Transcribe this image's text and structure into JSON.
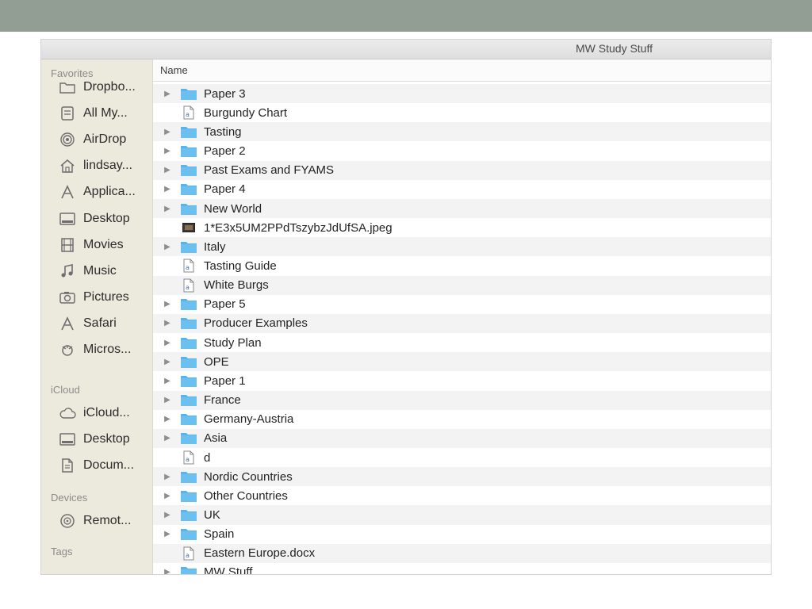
{
  "window": {
    "title": "MW Study Stuff"
  },
  "sidebar": {
    "sections": [
      {
        "heading": "Favorites",
        "items": [
          {
            "label": "Dropbo...",
            "icon": "folder-icon"
          },
          {
            "label": "All My...",
            "icon": "all-files-icon"
          },
          {
            "label": "AirDrop",
            "icon": "airdrop-icon"
          },
          {
            "label": "lindsay...",
            "icon": "home-icon"
          },
          {
            "label": "Applica...",
            "icon": "applications-icon"
          },
          {
            "label": "Desktop",
            "icon": "desktop-icon"
          },
          {
            "label": "Movies",
            "icon": "movies-icon"
          },
          {
            "label": "Music",
            "icon": "music-icon"
          },
          {
            "label": "Pictures",
            "icon": "pictures-icon"
          },
          {
            "label": "Safari",
            "icon": "applications-icon"
          },
          {
            "label": "Micros...",
            "icon": "app-icon"
          }
        ]
      },
      {
        "heading": "iCloud",
        "items": [
          {
            "label": "iCloud...",
            "icon": "cloud-icon"
          },
          {
            "label": "Desktop",
            "icon": "desktop-icon"
          },
          {
            "label": "Docum...",
            "icon": "documents-icon"
          }
        ]
      },
      {
        "heading": "Devices",
        "items": [
          {
            "label": "Remot...",
            "icon": "disc-icon"
          }
        ]
      },
      {
        "heading": "Tags",
        "items": []
      }
    ]
  },
  "list": {
    "column_name": "Name",
    "rows": [
      {
        "name": "Paper 3",
        "kind": "folder"
      },
      {
        "name": "Burgundy Chart",
        "kind": "document"
      },
      {
        "name": "Tasting",
        "kind": "folder"
      },
      {
        "name": "Paper 2",
        "kind": "folder"
      },
      {
        "name": "Past Exams and FYAMS",
        "kind": "folder"
      },
      {
        "name": "Paper 4",
        "kind": "folder"
      },
      {
        "name": "New World",
        "kind": "folder"
      },
      {
        "name": "1*E3x5UM2PPdTszybzJdUfSA.jpeg",
        "kind": "image"
      },
      {
        "name": "Italy",
        "kind": "folder"
      },
      {
        "name": "Tasting Guide",
        "kind": "document"
      },
      {
        "name": "White Burgs",
        "kind": "document"
      },
      {
        "name": "Paper 5",
        "kind": "folder"
      },
      {
        "name": "Producer Examples",
        "kind": "folder"
      },
      {
        "name": "Study Plan",
        "kind": "folder"
      },
      {
        "name": "OPE",
        "kind": "folder"
      },
      {
        "name": "Paper 1",
        "kind": "folder"
      },
      {
        "name": "France",
        "kind": "folder"
      },
      {
        "name": "Germany-Austria",
        "kind": "folder"
      },
      {
        "name": "Asia",
        "kind": "folder"
      },
      {
        "name": "d",
        "kind": "document"
      },
      {
        "name": "Nordic Countries",
        "kind": "folder"
      },
      {
        "name": "Other Countries",
        "kind": "folder"
      },
      {
        "name": "UK",
        "kind": "folder"
      },
      {
        "name": "Spain",
        "kind": "folder"
      },
      {
        "name": "Eastern Europe.docx",
        "kind": "document"
      },
      {
        "name": "MW Stuff",
        "kind": "folder"
      }
    ]
  },
  "colors": {
    "slide_band": "#929e94",
    "sidebar_bg": "#ece9dd",
    "folder_blue": "#5ab4ea",
    "row_alt": "#f3f3f3"
  }
}
